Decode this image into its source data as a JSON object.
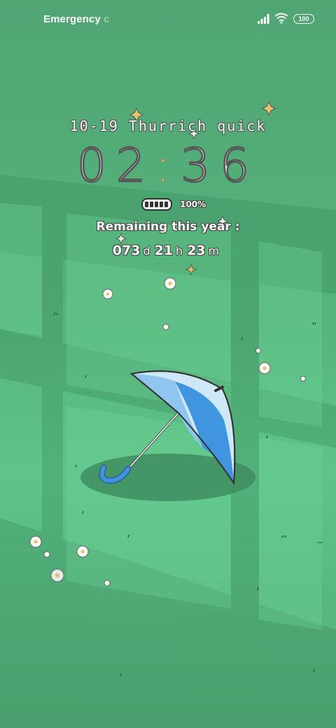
{
  "status_bar": {
    "carrier": "Emergency",
    "carrier_cut": "c",
    "battery_level": "100"
  },
  "lockscreen": {
    "date": "10-19",
    "weekday": "Thur",
    "greeting": "rich quick",
    "time_hours": "02",
    "time_minutes": "36",
    "battery_percent": "100%",
    "remaining_label": "Remaining this year :",
    "countdown": {
      "days": "073",
      "days_unit": "d",
      "hours": "21",
      "hours_unit": "h",
      "minutes": "23",
      "minutes_unit": "m"
    }
  },
  "wallpaper": {
    "subject": "umbrella-on-grass",
    "colors": {
      "grass": "#56b47d",
      "umbrella_light": "#cfe8f8",
      "umbrella_dark": "#3f95e0",
      "shadow": "#3d8a5c"
    }
  }
}
